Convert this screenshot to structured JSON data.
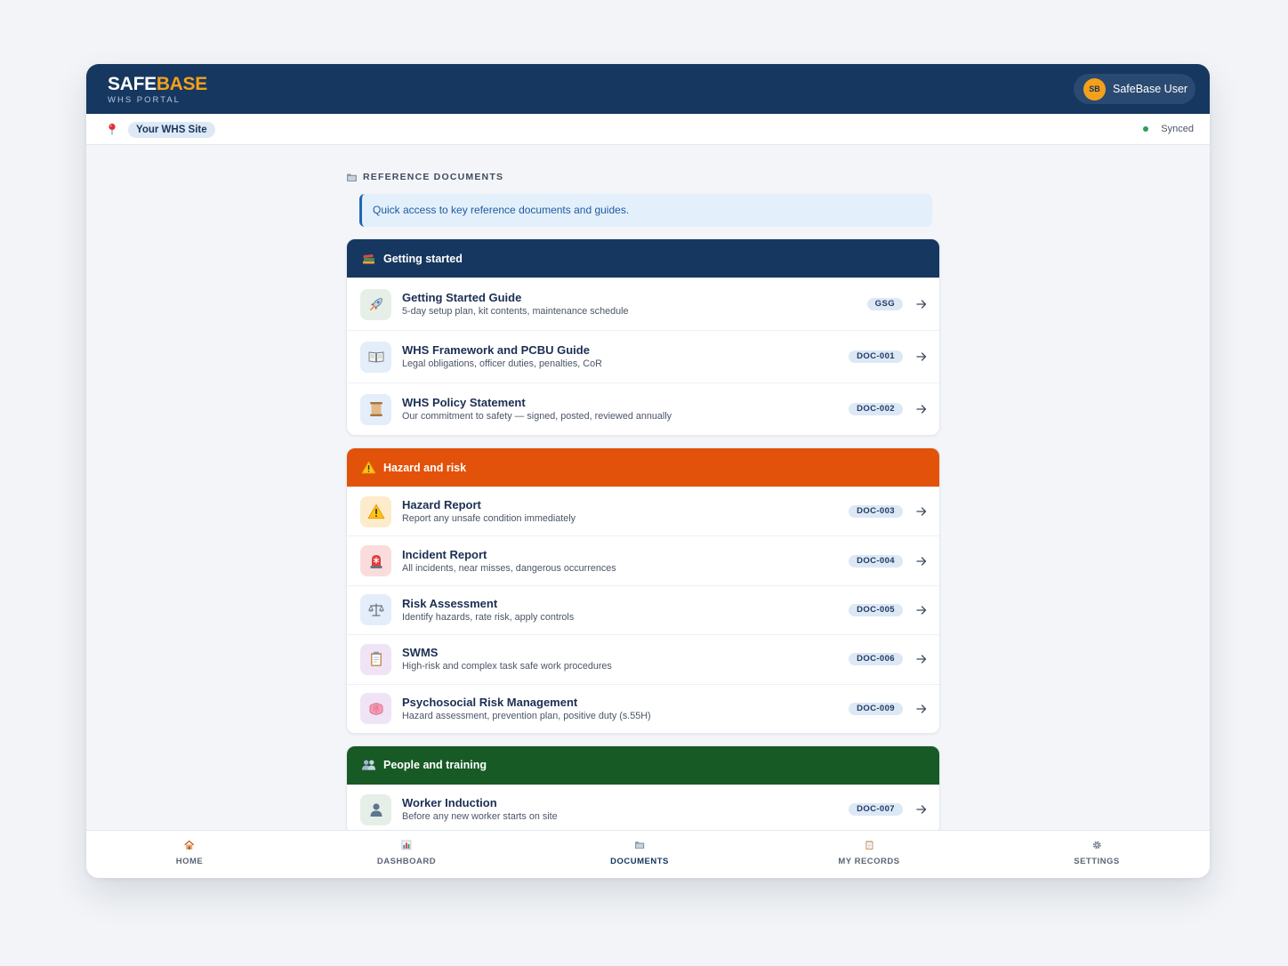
{
  "header": {
    "brand_part1": "SAFE",
    "brand_part2": "BASE",
    "brand_sub": "WHS PORTAL",
    "user_initials": "SB",
    "user_name": "SafeBase User"
  },
  "site_bar": {
    "site_label": "Your WHS Site",
    "sync_status": "Synced"
  },
  "documents": {
    "section_title": "REFERENCE DOCUMENTS",
    "info_text": "Quick access to key reference documents and guides.",
    "groups": [
      {
        "title": "Getting started",
        "icon": "books-icon",
        "color": "#163760",
        "items": [
          {
            "title": "Getting Started Guide",
            "desc": "5-day setup plan, kit contents, maintenance schedule",
            "code": "GSG",
            "icon": "rocket-icon"
          },
          {
            "title": "WHS Framework and PCBU Guide",
            "desc": "Legal obligations, officer duties, penalties, CoR",
            "code": "DOC-001",
            "icon": "book-icon"
          },
          {
            "title": "WHS Policy Statement",
            "desc": "Our commitment to safety — signed, posted, reviewed annually",
            "code": "DOC-002",
            "icon": "scroll-icon"
          }
        ]
      },
      {
        "title": "Hazard and risk",
        "icon": "warning-icon",
        "color": "#e2520b",
        "items": [
          {
            "title": "Hazard Report",
            "desc": "Report any unsafe condition immediately",
            "code": "DOC-003",
            "icon": "warning-icon"
          },
          {
            "title": "Incident Report",
            "desc": "All incidents, near misses, dangerous occurrences",
            "code": "DOC-004",
            "icon": "siren-icon"
          },
          {
            "title": "Risk Assessment",
            "desc": "Identify hazards, rate risk, apply controls",
            "code": "DOC-005",
            "icon": "scales-icon"
          },
          {
            "title": "SWMS",
            "desc": "High-risk and complex task safe work procedures",
            "code": "DOC-006",
            "icon": "clipboard-icon"
          },
          {
            "title": "Psychosocial Risk Management",
            "desc": "Hazard assessment, prevention plan, positive duty (s.55H)",
            "code": "DOC-009",
            "icon": "brain-icon"
          }
        ]
      },
      {
        "title": "People and training",
        "icon": "people-icon",
        "color": "#175a25",
        "items": [
          {
            "title": "Worker Induction",
            "desc": "Before any new worker starts on site",
            "code": "DOC-007",
            "icon": "person-icon"
          }
        ]
      }
    ]
  },
  "bottom_nav": [
    {
      "label": "HOME",
      "icon": "house-icon",
      "active": false
    },
    {
      "label": "DASHBOARD",
      "icon": "bar-chart-icon",
      "active": false
    },
    {
      "label": "DOCUMENTS",
      "icon": "folder-icon",
      "active": true
    },
    {
      "label": "MY RECORDS",
      "icon": "records-icon",
      "active": false
    },
    {
      "label": "SETTINGS",
      "icon": "gear-icon",
      "active": false
    }
  ]
}
